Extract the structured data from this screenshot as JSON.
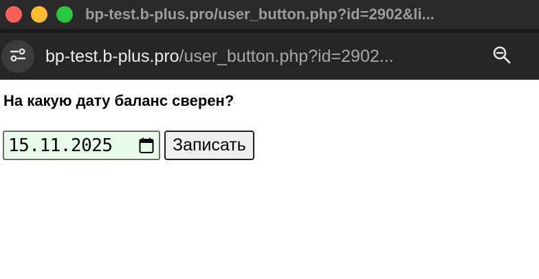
{
  "window": {
    "title": "bp-test.b-plus.pro/user_button.php?id=2902&li..."
  },
  "address_bar": {
    "host": "bp-test.b-plus.pro",
    "path": "/user_button.php?id=2902..."
  },
  "icons": {
    "site_controls": "sliders-icon",
    "zoom": "zoom-out-icon",
    "calendar": "calendar-icon"
  },
  "colors": {
    "close": "#fe5f57",
    "minimize": "#febc2e",
    "maximize": "#28c840",
    "date_field_bg": "#e8fbe9"
  },
  "form": {
    "question": "На какую дату баланс сверен?",
    "date_value": "15.11.2025",
    "submit_label": "Записать"
  }
}
